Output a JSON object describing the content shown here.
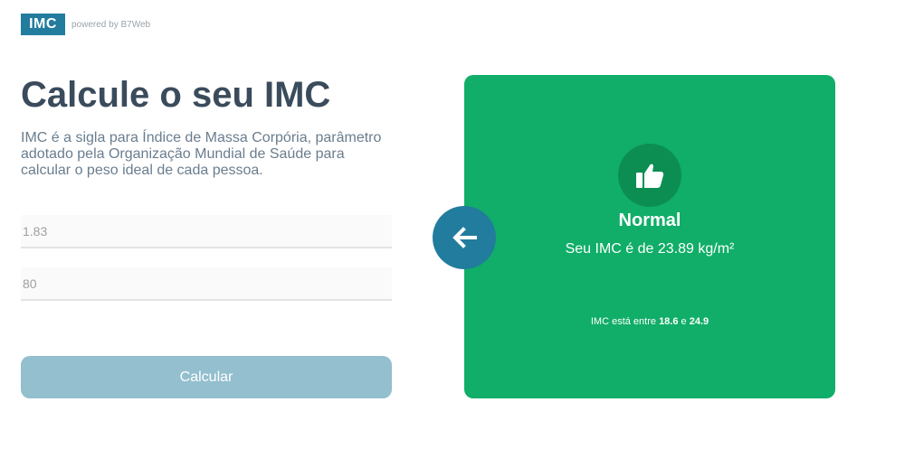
{
  "header": {
    "logo_text": "IMC",
    "powered_by": "powered by B7Web"
  },
  "intro": {
    "title": "Calcule o seu IMC",
    "description": "IMC é a sigla para Índice de Massa Corpória, parâmetro adotado pela Organização Mundial de Saúde para calcular o peso ideal de cada pessoa."
  },
  "form": {
    "height_value": "1.83",
    "weight_value": "80",
    "calculate_label": "Calcular"
  },
  "result": {
    "icon": "thumbs-up-icon",
    "title": "Normal",
    "value_text": "Seu IMC é de 23.89 kg/m²",
    "range_prefix": "IMC está entre ",
    "range_min": "18.6",
    "range_joiner": " e ",
    "range_max": "24.9"
  },
  "back_button": {
    "icon": "arrow-left-icon"
  },
  "colors": {
    "brand": "#227c9d",
    "result_bg": "#10ae68",
    "button_disabled": "#93bfce"
  }
}
